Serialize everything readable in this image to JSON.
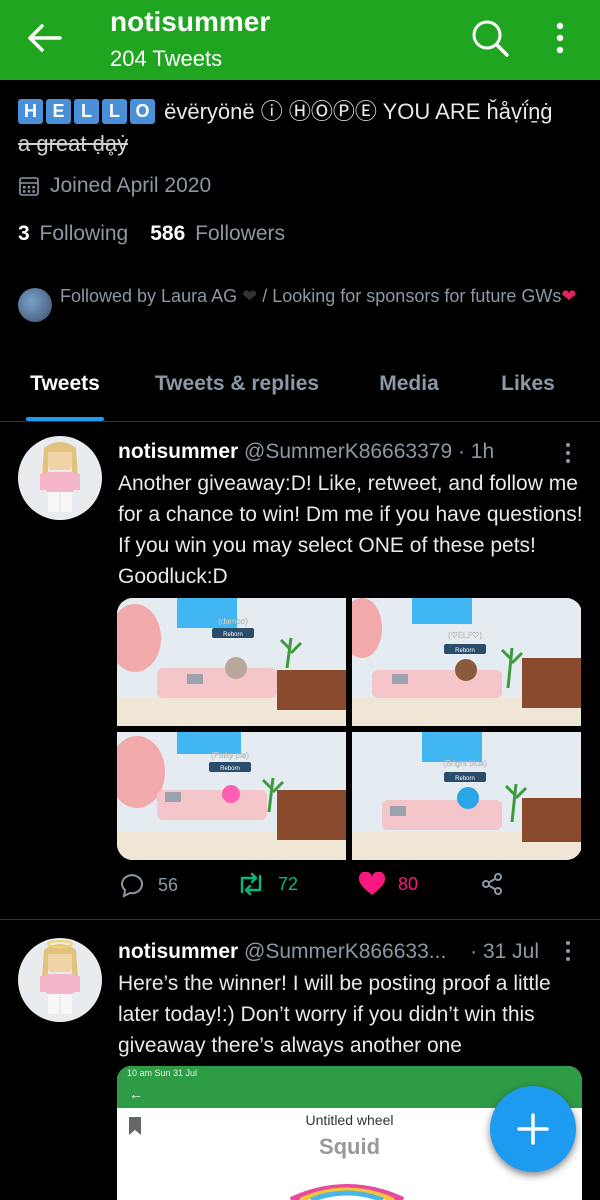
{
  "header": {
    "name": "notisummer",
    "tweet_count": "204 Tweets"
  },
  "bio": {
    "hello_letters": [
      "H",
      "E",
      "L",
      "L",
      "O"
    ],
    "line1_rest": "ëvëryönë ⓘ ⒽⓄⓅⒺ YOU ARE ȟåṿḯṉġ",
    "line2": "a great ḍḁẏ"
  },
  "joined": "Joined April 2020",
  "follow": {
    "following_count": "3",
    "following_label": "Following",
    "followers_count": "586",
    "followers_label": "Followers"
  },
  "followed_by": {
    "text": "Followed by Laura AG",
    "middle": " / Looking for sponsors for future GWs"
  },
  "tabs": [
    "Tweets",
    "Tweets & replies",
    "Media",
    "Likes"
  ],
  "tweets": [
    {
      "name": "notisummer",
      "handle": "@SummerK86663379 · 1h",
      "text": "Another giveaway:D! Like, retweet, and follow me for a chance to win! Dm me if you have questions! If you win you may select ONE of these pets! Goodluck:D",
      "images": [
        {
          "label": "(dumbo)",
          "tag": "Reborn",
          "pet": "#b9a79a"
        },
        {
          "label": "(♡ELF♡)",
          "tag": "Reborn",
          "pet": "#8a5a3c"
        },
        {
          "label": "(Pinky pie)",
          "tag": "Reborn",
          "pet": "#ff5fb3"
        },
        {
          "label": "(Bright blue)",
          "tag": "Reborn",
          "pet": "#2aa6e8"
        }
      ],
      "replies": "56",
      "retweets": "72",
      "likes": "80"
    },
    {
      "name": "notisummer",
      "handle": "@SummerK866633...",
      "date": "· 31 Jul",
      "text": "Here’s the winner! I will be posting proof a little later today!:) Don’t worry if you didn’t win this giveaway there’s always another one",
      "preview": {
        "status": "10 am  Sun 31 Jul",
        "title": "Untitled wheel",
        "result": "Squid"
      }
    }
  ],
  "colors": {
    "header_bg": "#1fa51f",
    "accent": "#1d9bf0",
    "like": "#f91880",
    "retweet": "#00ba7c"
  }
}
